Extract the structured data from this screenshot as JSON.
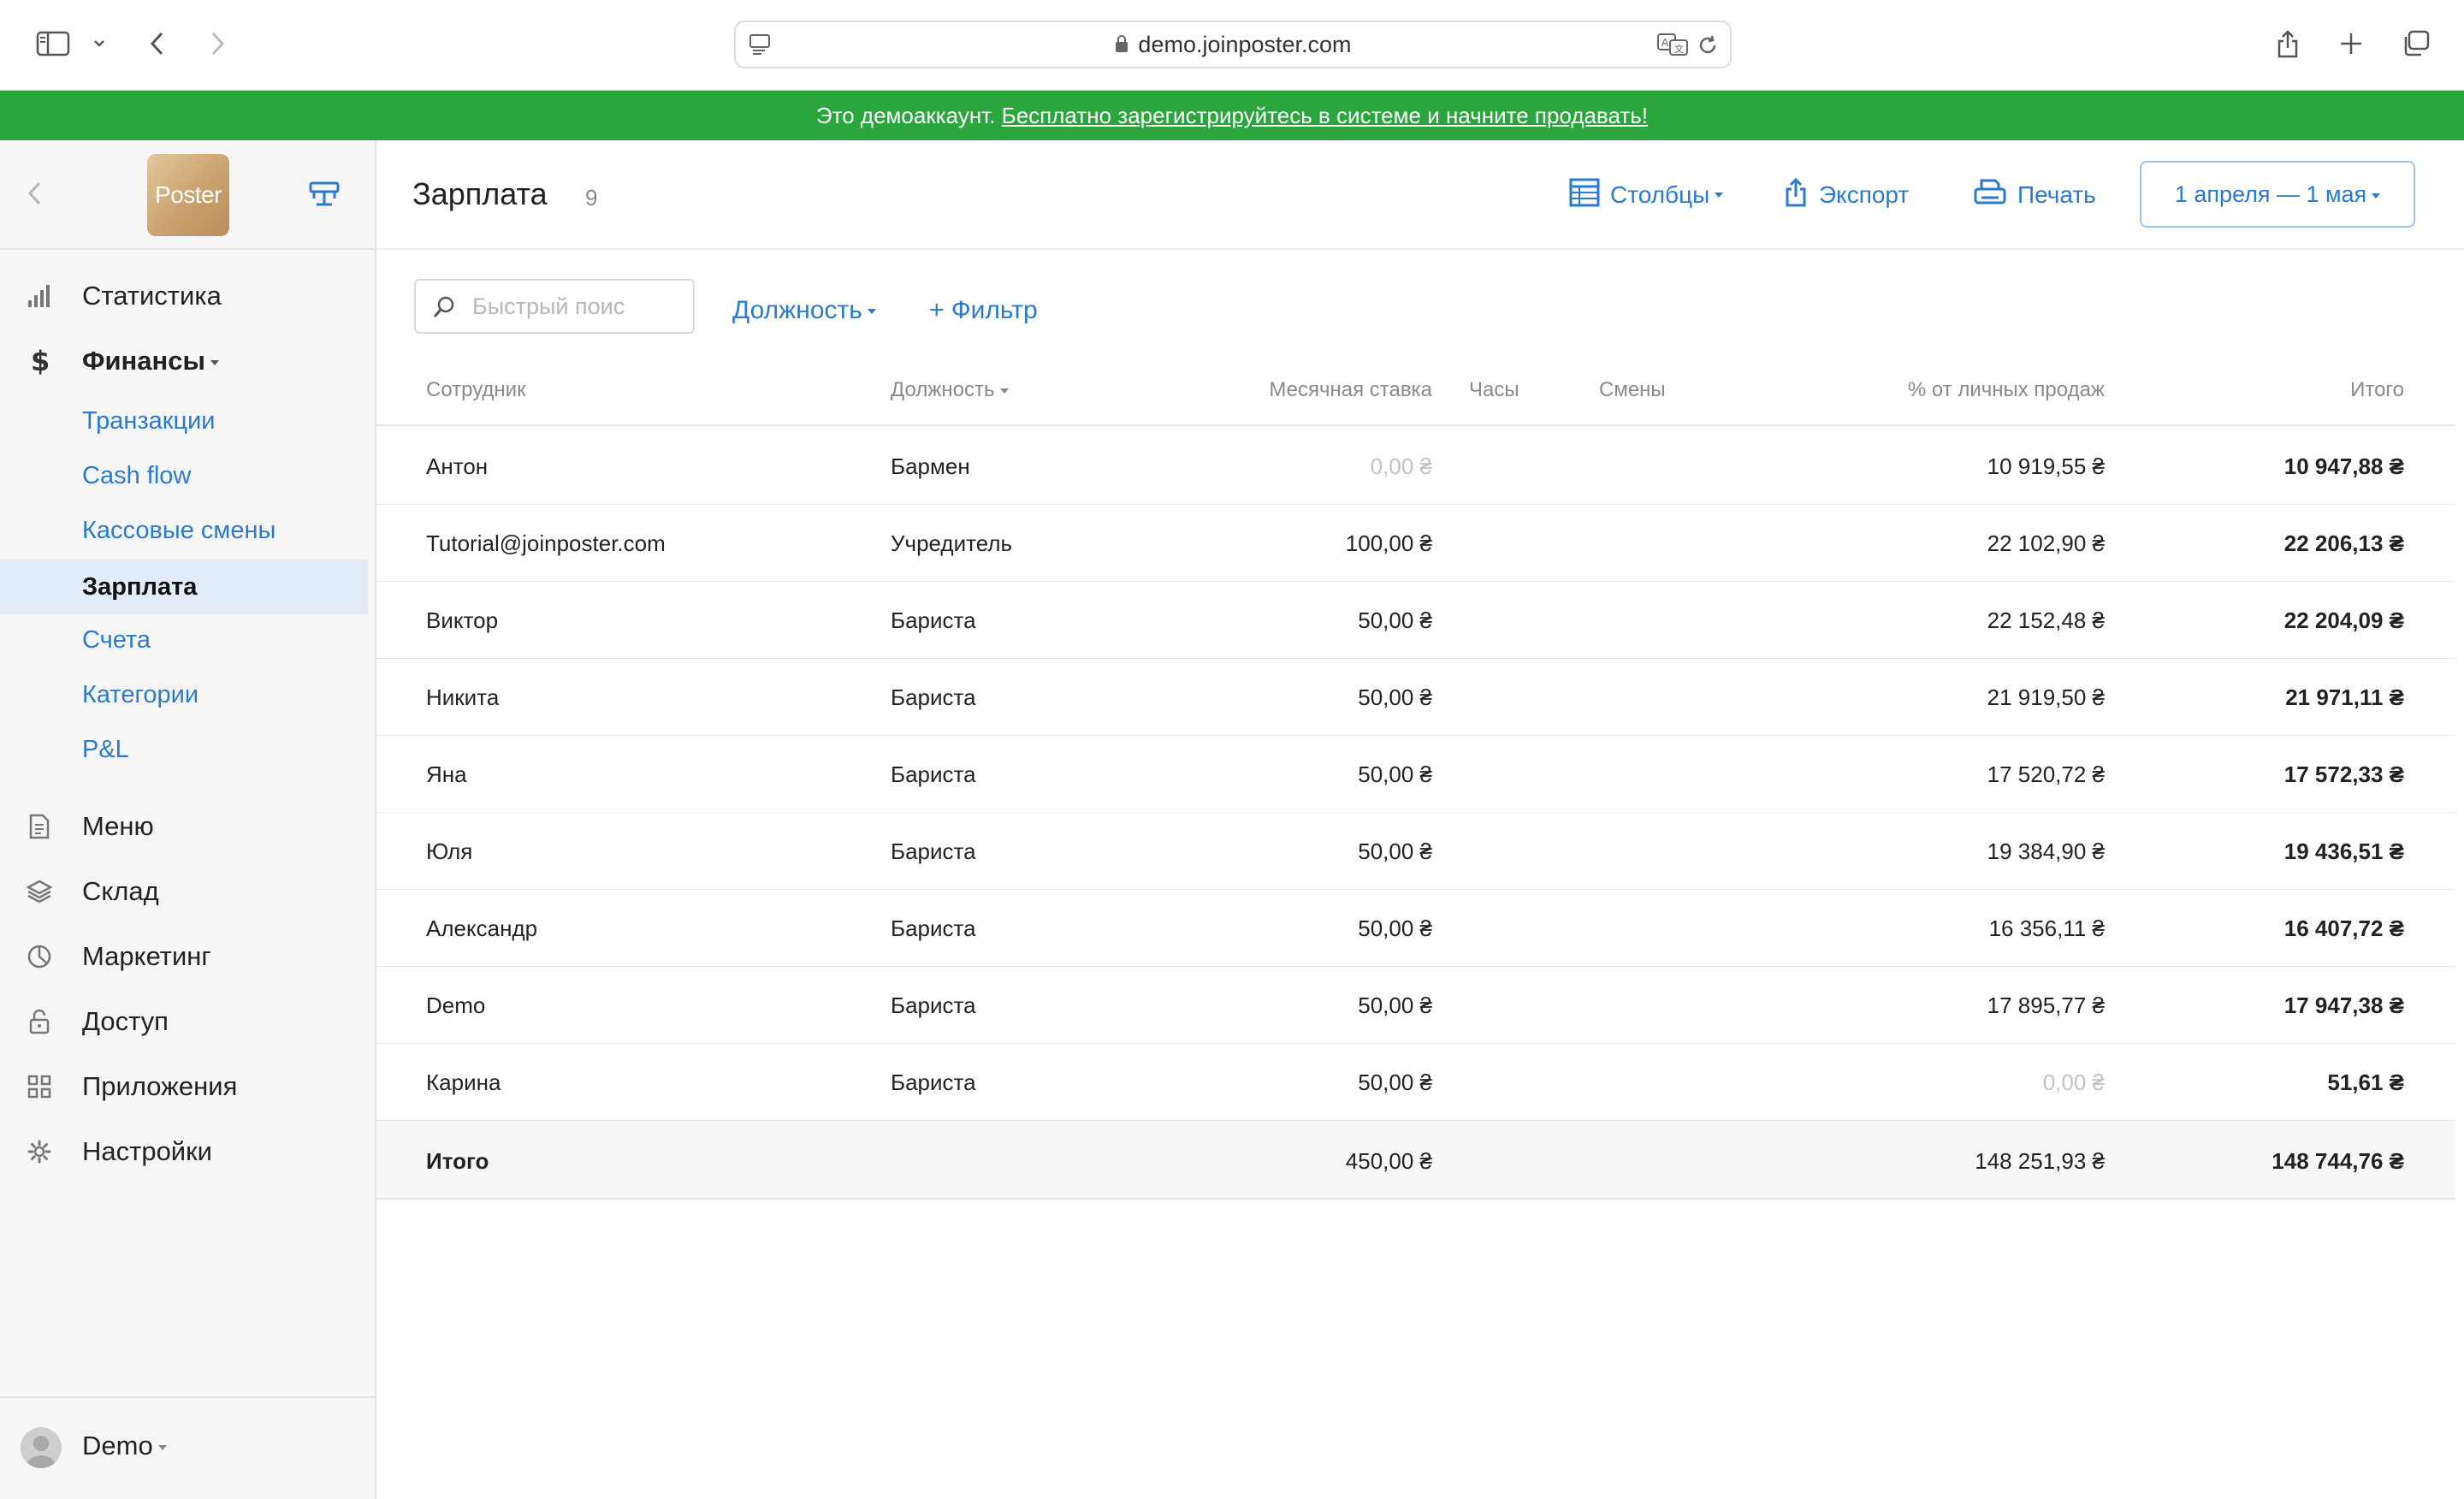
{
  "browser": {
    "url": "demo.joinposter.com"
  },
  "banner": {
    "text": "Это демоаккаунт. ",
    "link": "Бесплатно зарегистрируйтесь в системе и начните продавать!"
  },
  "sidebar": {
    "logo_text": "Poster",
    "nav": {
      "statistics": "Статистика",
      "finance": "Финансы",
      "finance_sub": [
        "Транзакции",
        "Cash flow",
        "Кассовые смены",
        "Зарплата",
        "Счета",
        "Категории",
        "P&L"
      ],
      "menu": "Меню",
      "warehouse": "Склад",
      "marketing": "Маркетинг",
      "access": "Доступ",
      "apps": "Приложения",
      "settings": "Настройки"
    },
    "user": "Demo"
  },
  "header": {
    "title": "Зарплата",
    "count": "9",
    "columns_btn": "Столбцы",
    "export_btn": "Экспорт",
    "print_btn": "Печать",
    "date_range": "1 апреля — 1 мая"
  },
  "toolbar": {
    "search_placeholder": "Быстрый поис",
    "position_filter": "Должность",
    "add_filter": "+ Фильтр"
  },
  "table": {
    "columns": {
      "employee": "Сотрудник",
      "position": "Должность",
      "monthly_rate": "Месячная ставка",
      "hours": "Часы",
      "shifts": "Смены",
      "sales_pct": "% от личных продаж",
      "total": "Итого"
    },
    "rows": [
      {
        "name": "Антон",
        "position": "Бармен",
        "rate": "0,00 ₴",
        "pct": "10 919,55 ₴",
        "total": "10 947,88 ₴"
      },
      {
        "name": "Tutorial@joinposter.com",
        "position": "Учредитель",
        "rate": "100,00 ₴",
        "pct": "22 102,90 ₴",
        "total": "22 206,13 ₴"
      },
      {
        "name": "Виктор",
        "position": "Бариста",
        "rate": "50,00 ₴",
        "pct": "22 152,48 ₴",
        "total": "22 204,09 ₴"
      },
      {
        "name": "Никита",
        "position": "Бариста",
        "rate": "50,00 ₴",
        "pct": "21 919,50 ₴",
        "total": "21 971,11 ₴"
      },
      {
        "name": "Яна",
        "position": "Бариста",
        "rate": "50,00 ₴",
        "pct": "17 520,72 ₴",
        "total": "17 572,33 ₴"
      },
      {
        "name": "Юля",
        "position": "Бариста",
        "rate": "50,00 ₴",
        "pct": "19 384,90 ₴",
        "total": "19 436,51 ₴"
      },
      {
        "name": "Александр",
        "position": "Бариста",
        "rate": "50,00 ₴",
        "pct": "16 356,11 ₴",
        "total": "16 407,72 ₴"
      },
      {
        "name": "Demo",
        "position": "Бариста",
        "rate": "50,00 ₴",
        "pct": "17 895,77 ₴",
        "total": "17 947,38 ₴"
      },
      {
        "name": "Карина",
        "position": "Бариста",
        "rate": "50,00 ₴",
        "pct": "0,00 ₴",
        "total": "51,61 ₴"
      }
    ],
    "totals": {
      "label": "Итого",
      "rate": "450,00 ₴",
      "pct": "148 251,93 ₴",
      "total": "148 744,76 ₴"
    }
  },
  "colors": {
    "accent": "#2a7ad1",
    "banner": "#2aa63d",
    "active_nav_bg": "#e1ecf8"
  }
}
